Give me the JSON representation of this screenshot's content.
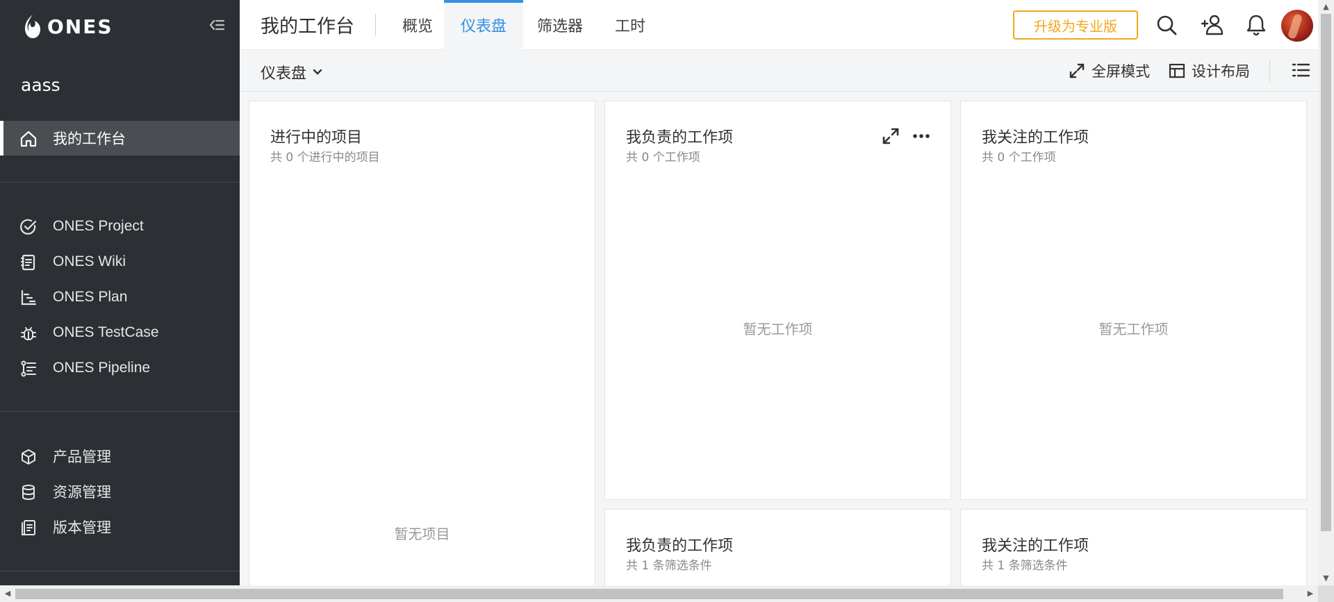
{
  "sidebar": {
    "brand": "ONES",
    "team": "aass",
    "workspace": {
      "label": "我的工作台",
      "icon": "home-icon"
    },
    "products": [
      {
        "label": "ONES Project",
        "icon": "check-circle-icon"
      },
      {
        "label": "ONES Wiki",
        "icon": "wiki-book-icon"
      },
      {
        "label": "ONES Plan",
        "icon": "gantt-icon"
      },
      {
        "label": "ONES TestCase",
        "icon": "bug-icon"
      },
      {
        "label": "ONES Pipeline",
        "icon": "pipeline-icon"
      }
    ],
    "management": [
      {
        "label": "产品管理",
        "icon": "cube-icon"
      },
      {
        "label": "资源管理",
        "icon": "database-icon"
      },
      {
        "label": "版本管理",
        "icon": "version-icon"
      }
    ]
  },
  "header": {
    "title": "我的工作台",
    "tabs": [
      {
        "label": "概览"
      },
      {
        "label": "仪表盘",
        "active": true
      },
      {
        "label": "筛选器"
      },
      {
        "label": "工时"
      }
    ],
    "upgrade_label": "升级为专业版",
    "accent_color": "#338fe5",
    "upgrade_color": "#f0a81d"
  },
  "subbar": {
    "dashboard_select": "仪表盘",
    "fullscreen_label": "全屏模式",
    "layout_label": "设计布局"
  },
  "cards": [
    {
      "title": "进行中的项目",
      "subtitle": "共 0 个进行中的项目",
      "empty": "暂无项目"
    },
    {
      "title": "我负责的工作项",
      "subtitle": "共 0 个工作项",
      "empty": "暂无工作项"
    },
    {
      "title": "我关注的工作项",
      "subtitle": "共 0 个工作项",
      "empty": "暂无工作项"
    },
    {
      "title": "我负责的工作项",
      "subtitle": "共 1 条筛选条件"
    },
    {
      "title": "我关注的工作项",
      "subtitle": "共 1 条筛选条件"
    }
  ]
}
